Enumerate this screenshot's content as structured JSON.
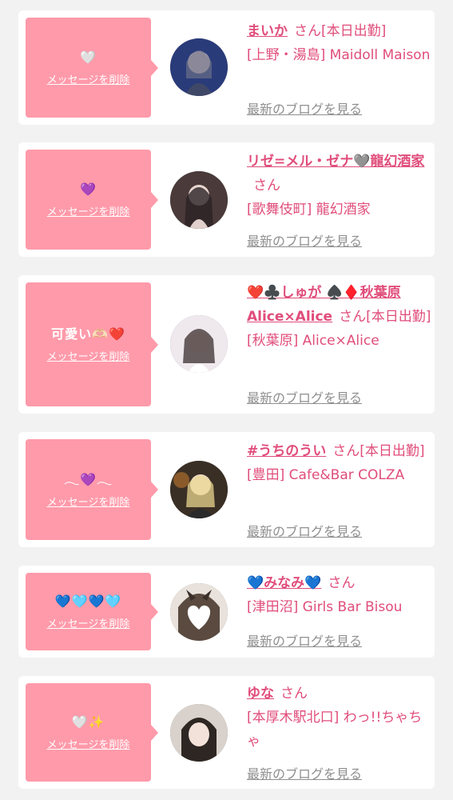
{
  "delete_label": "メッセージを削除",
  "blog_label": "最新のブログを見る",
  "honorific": "さん",
  "accent_color": "#e04d7b",
  "bubble_color": "#ff9aaa",
  "entries": [
    {
      "message": "🤍",
      "name": "まいか",
      "status": "[本日出勤]",
      "shop": "[上野・湯島] Maidoll Maison"
    },
    {
      "message": "💜",
      "name": "リゼ=メル・ゼナ🩶龍幻酒家",
      "status": "",
      "shop": "[歌舞伎町] 龍幻酒家"
    },
    {
      "message": "可愛い🫶🏻❤️",
      "name": "❤️♣️しゅが ♠️♦️秋葉原Alice×Alice",
      "status": "[本日出勤]",
      "shop": "[秋葉原] Alice×Alice"
    },
    {
      "message": "𓂃💜𓂃",
      "name": "#うちのうい",
      "status": "[本日出勤]",
      "shop": "[豊田] Cafe&Bar COLZA"
    },
    {
      "message": "💙🩵💙🩵",
      "name": "💙みなみ💙",
      "status": "",
      "shop": "[津田沼] Girls Bar Bisou"
    },
    {
      "message": "🤍✨",
      "name": "ゆな",
      "status": "",
      "shop": "[本厚木駅北口] わっ!!ちゃちゃ"
    }
  ]
}
